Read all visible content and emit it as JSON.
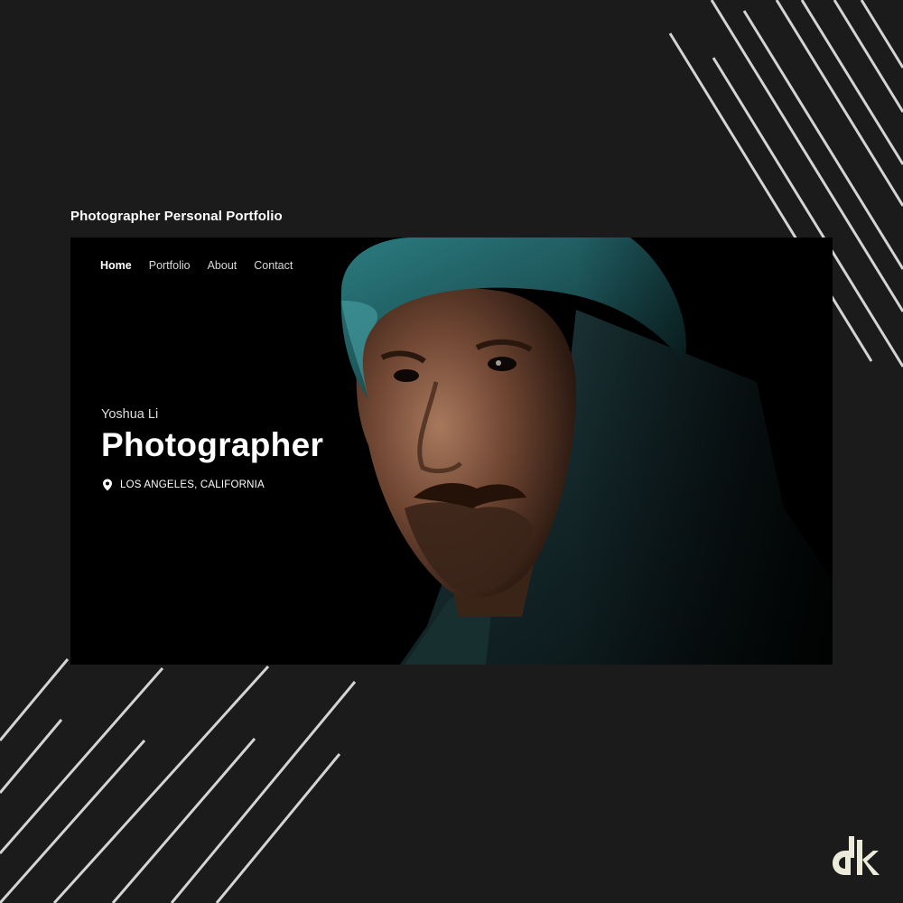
{
  "caption": "Photographer Personal Portfolio",
  "nav": {
    "items": [
      {
        "label": "Home",
        "active": true
      },
      {
        "label": "Portfolio",
        "active": false
      },
      {
        "label": "About",
        "active": false
      },
      {
        "label": "Contact",
        "active": false
      }
    ]
  },
  "hero": {
    "name": "Yoshua Li",
    "title": "Photographer",
    "location": "LOS ANGELES, CALIFORNIA",
    "location_icon": "map-pin-icon",
    "photo": "portrait of man in teal knit beanie and dark hooded jacket"
  },
  "brand": {
    "logo_icon": "dk-logo-icon",
    "logo_text": "dk"
  },
  "colors": {
    "background": "#1b1b1b",
    "mockup_bg": "#000000",
    "deco_line": "#d4d4d4",
    "beanie": "#1f5a5e",
    "logo": "#ecebd9"
  }
}
